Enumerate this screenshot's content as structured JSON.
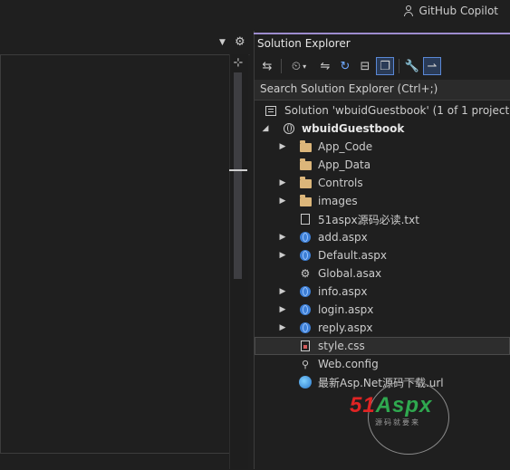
{
  "top_bar": {
    "copilot_label": "GitHub Copilot",
    "copilot_icon": "person-icon"
  },
  "editor": {
    "split_icon": "split-editor-icon",
    "dropdown_icon": "chevron-down-icon",
    "gear_icon": "gear-icon"
  },
  "solution_explorer": {
    "title": "Solution Explorer",
    "toolbar": [
      {
        "name": "switch-views-icon",
        "glyph": "⇆"
      },
      {
        "name": "pending-changes-icon",
        "glyph": "⏲"
      },
      {
        "name": "sync-icon",
        "glyph": "⇋"
      },
      {
        "name": "refresh-icon",
        "glyph": "↻"
      },
      {
        "name": "collapse-all-icon",
        "glyph": "⊟"
      },
      {
        "name": "show-all-files-icon",
        "glyph": "❐"
      },
      {
        "name": "properties-icon",
        "glyph": "🔧"
      },
      {
        "name": "preview-icon",
        "glyph": "⇀"
      }
    ],
    "search_placeholder": "Search Solution Explorer (Ctrl+;)",
    "tree": [
      {
        "label": "Solution 'wbuidGuestbook' (1 of 1 project)",
        "icon": "solution-icon",
        "level": 0,
        "chevron": ""
      },
      {
        "label": "wbuidGuestbook",
        "icon": "web-project-icon",
        "level": 0,
        "chevron": "expanded",
        "bold": true
      },
      {
        "label": "App_Code",
        "icon": "folder-icon",
        "level": 1,
        "chevron": "collapsed"
      },
      {
        "label": "App_Data",
        "icon": "folder-icon",
        "level": 1,
        "chevron": ""
      },
      {
        "label": "Controls",
        "icon": "folder-icon",
        "level": 1,
        "chevron": "collapsed"
      },
      {
        "label": "images",
        "icon": "folder-icon",
        "level": 1,
        "chevron": "collapsed"
      },
      {
        "label": "51aspx源码必读.txt",
        "icon": "text-file-icon",
        "level": 1,
        "chevron": ""
      },
      {
        "label": "add.aspx",
        "icon": "aspx-file-icon",
        "level": 1,
        "chevron": "collapsed"
      },
      {
        "label": "Default.aspx",
        "icon": "aspx-file-icon",
        "level": 1,
        "chevron": "collapsed"
      },
      {
        "label": "Global.asax",
        "icon": "asax-file-icon",
        "level": 1,
        "chevron": ""
      },
      {
        "label": "info.aspx",
        "icon": "aspx-file-icon",
        "level": 1,
        "chevron": "collapsed"
      },
      {
        "label": "login.aspx",
        "icon": "aspx-file-icon",
        "level": 1,
        "chevron": "collapsed"
      },
      {
        "label": "reply.aspx",
        "icon": "aspx-file-icon",
        "level": 1,
        "chevron": "collapsed"
      },
      {
        "label": "style.css",
        "icon": "css-file-icon",
        "level": 1,
        "chevron": "",
        "selected": true
      },
      {
        "label": "Web.config",
        "icon": "config-file-icon",
        "level": 1,
        "chevron": ""
      },
      {
        "label": "最新Asp.Net源码下载.url",
        "icon": "url-file-icon",
        "level": 1,
        "chevron": ""
      }
    ]
  },
  "watermark": {
    "logo_51": "51",
    "logo_aspx": "Aspx",
    "subtitle": "源码就要来"
  }
}
